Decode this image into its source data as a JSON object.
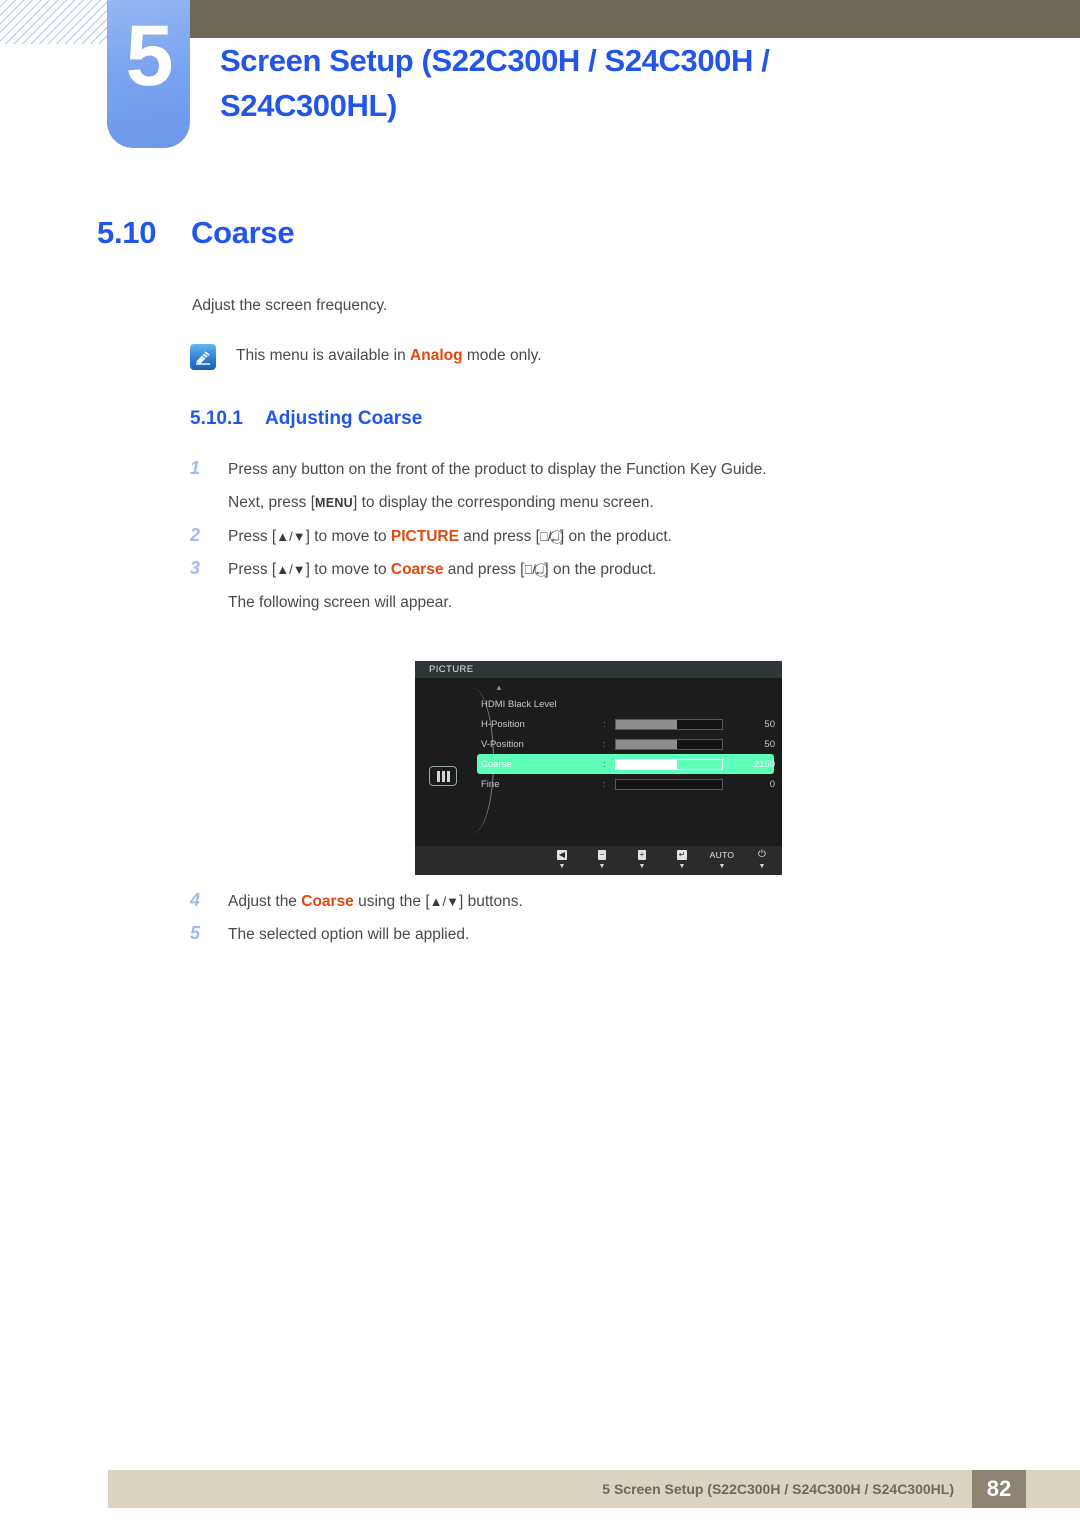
{
  "header": {
    "chapter_number": "5",
    "chapter_title": "Screen Setup (S22C300H / S24C300H / S24C300HL)",
    "accent_blue": "#2256ea",
    "olive": "#6c6a57"
  },
  "section": {
    "number": "5.10",
    "title": "Coarse",
    "intro": "Adjust the screen frequency."
  },
  "note": {
    "icon": "note-pen-icon",
    "text_before": "This menu is available in ",
    "keyword": "Analog",
    "text_after": " mode only.",
    "keyword_color": "#e0490f"
  },
  "subsection": {
    "number": "5.10.1",
    "title": "Adjusting Coarse"
  },
  "steps": [
    {
      "num": "1",
      "text": "Press any button on the front of the product to display the Function Key Guide.",
      "sub": {
        "before": "Next, press [",
        "key": "MENU",
        "after": "] to display the corresponding menu screen."
      }
    },
    {
      "num": "2",
      "parts": {
        "p1": "Press [",
        "arrows": "▲/▼",
        "p2": "] to move to ",
        "kw": "PICTURE",
        "p3": " and press [",
        "p4": "] on the product."
      }
    },
    {
      "num": "3",
      "parts": {
        "p1": "Press [",
        "arrows": "▲/▼",
        "p2": "] to move to ",
        "kw": "Coarse",
        "p3": " and press [",
        "p4": "] on the product."
      },
      "sub_plain": "The following screen will appear."
    },
    {
      "num": "4",
      "parts": {
        "p1": "Adjust the ",
        "kw": "Coarse",
        "p2": " using the [",
        "arrows": "▲/▼",
        "p3": "] buttons."
      }
    },
    {
      "num": "5",
      "text": "The selected option will be applied."
    }
  ],
  "osd": {
    "title": "PICTURE",
    "menu_icon": "picture-bars-icon",
    "scroll_up_indicator": "▲",
    "rows": [
      {
        "label": "HDMI Black Level",
        "has_bar": false,
        "value": ""
      },
      {
        "label": "H-Position",
        "has_bar": true,
        "fill_pct": 58,
        "value": "50"
      },
      {
        "label": "V-Position",
        "has_bar": true,
        "fill_pct": 58,
        "value": "50"
      },
      {
        "label": "Coarse",
        "has_bar": true,
        "fill_pct": 58,
        "value": "2160",
        "selected": true
      },
      {
        "label": "Fine",
        "has_bar": true,
        "fill_pct": 0,
        "value": "0"
      }
    ],
    "highlight_color": "#5effb8",
    "buttons": [
      {
        "icon": "back-arrow-icon",
        "glyph": "◀",
        "caption": ""
      },
      {
        "icon": "minus-icon",
        "glyph": "−",
        "caption": ""
      },
      {
        "icon": "plus-icon",
        "glyph": "+",
        "caption": ""
      },
      {
        "icon": "enter-icon",
        "glyph": "↵",
        "caption": ""
      },
      {
        "icon": "auto-label",
        "glyph": "",
        "caption": "AUTO"
      },
      {
        "icon": "power-icon",
        "glyph": "⏻",
        "caption": ""
      }
    ]
  },
  "footer": {
    "text": "5 Screen Setup (S22C300H / S24C300H / S24C300HL)",
    "page_number": "82"
  }
}
